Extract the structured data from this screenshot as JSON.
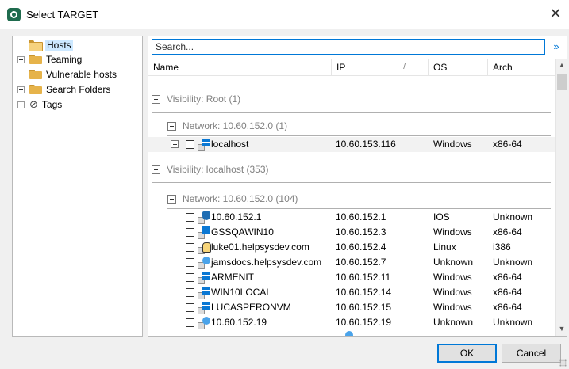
{
  "window": {
    "title": "Select TARGET"
  },
  "tree": {
    "items": [
      {
        "label": "Hosts",
        "expander": "none",
        "icon": "folder-open-icon",
        "selected": true
      },
      {
        "label": "Teaming",
        "expander": "plus",
        "icon": "folder-icon"
      },
      {
        "label": "Vulnerable hosts",
        "expander": "none",
        "icon": "folder-icon"
      },
      {
        "label": "Search Folders",
        "expander": "plus",
        "icon": "search-folder-icon"
      },
      {
        "label": "Tags",
        "expander": "plus",
        "icon": "tag-icon"
      }
    ]
  },
  "search": {
    "placeholder": "Search..."
  },
  "grid": {
    "columns": [
      "Name",
      "IP",
      "OS",
      "Arch"
    ],
    "sort_glyph": "/",
    "groups": [
      {
        "label": "Visibility: Root (1)"
      },
      {
        "label": "Network: 10.60.152.0 (1)"
      },
      {
        "label": "Visibility: localhost (353)"
      },
      {
        "label": "Network: 10.60.152.0 (104)"
      }
    ],
    "root_host": {
      "name": "localhost",
      "ip": "10.60.153.116",
      "os": "Windows",
      "arch": "x86-64",
      "icon": "windows-icon"
    },
    "hosts": [
      {
        "name": "10.60.152.1",
        "ip": "10.60.152.1",
        "os": "IOS",
        "arch": "Unknown",
        "icon": "shield-icon"
      },
      {
        "name": "GSSQAWIN10",
        "ip": "10.60.152.3",
        "os": "Windows",
        "arch": "x86-64",
        "icon": "windows-icon"
      },
      {
        "name": "luke01.helpsysdev.com",
        "ip": "10.60.152.4",
        "os": "Linux",
        "arch": "i386",
        "icon": "linux-icon"
      },
      {
        "name": "jamsdocs.helpsysdev.com",
        "ip": "10.60.152.7",
        "os": "Unknown",
        "arch": "Unknown",
        "icon": "unknown-icon"
      },
      {
        "name": "ARMENIT",
        "ip": "10.60.152.11",
        "os": "Windows",
        "arch": "x86-64",
        "icon": "windows-icon"
      },
      {
        "name": "WIN10LOCAL",
        "ip": "10.60.152.14",
        "os": "Windows",
        "arch": "x86-64",
        "icon": "windows-icon"
      },
      {
        "name": "LUCASPERONVM",
        "ip": "10.60.152.15",
        "os": "Windows",
        "arch": "x86-64",
        "icon": "windows-icon"
      },
      {
        "name": "10.60.152.19",
        "ip": "10.60.152.19",
        "os": "Unknown",
        "arch": "Unknown",
        "icon": "unknown-icon"
      }
    ]
  },
  "buttons": {
    "ok": "OK",
    "cancel": "Cancel"
  },
  "colors": {
    "accent": "#0078d7",
    "selection": "#cce8ff",
    "group_text": "#808080",
    "brand": "#1f6b4e"
  }
}
